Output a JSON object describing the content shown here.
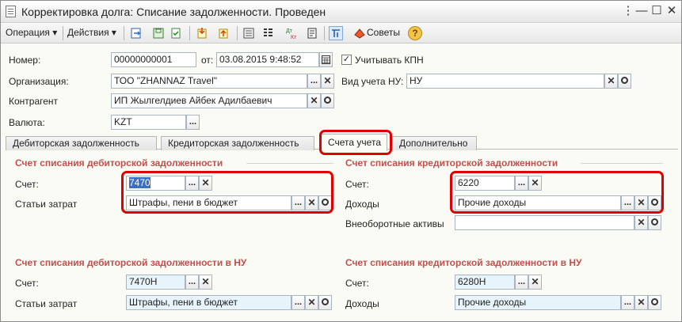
{
  "window": {
    "title": "Корректировка долга: Списание задолженности. Проведен",
    "controls": {
      "menu": "⋮",
      "minimize": "—",
      "maximize": "☐",
      "close": "✕"
    }
  },
  "toolbar": {
    "operation": "Операция",
    "actions": "Действия",
    "tips": "Советы",
    "help": "?"
  },
  "header": {
    "number_label": "Номер:",
    "number_value": "00000000001",
    "date_label": "от:",
    "date_value": "03.08.2015  9:48:52",
    "kpn_label": "Учитывать КПН",
    "kpn_checked": "✓",
    "org_label": "Организация:",
    "org_value": "ТОО  \"ZHANNAZ Travel\"",
    "accounting_label": "Вид учета НУ:",
    "accounting_value": "НУ",
    "contractor_label": "Контрагент",
    "contractor_value": "ИП Жылгелдиев Айбек Адилбаевич",
    "currency_label": "Валюта:",
    "currency_value": "KZT"
  },
  "tabs": [
    {
      "label": "Дебиторская задолженность"
    },
    {
      "label": "Кредиторская задолженность"
    },
    {
      "label": "Счета учета"
    },
    {
      "label": "Дополнительно"
    }
  ],
  "debit": {
    "title": "Счет списания дебиторской задолженности",
    "account_label": "Счет:",
    "account_value": "7470",
    "expense_label": "Статьи затрат",
    "expense_value": "Штрафы, пени в бюджет"
  },
  "credit": {
    "title": "Счет списания кредиторской задолженности",
    "account_label": "Счет:",
    "account_value": "6220",
    "income_label": "Доходы",
    "income_value": "Прочие доходы",
    "assets_label": "Внеоборотные активы",
    "assets_value": ""
  },
  "debit_nu": {
    "title": "Счет списания дебиторской задолженности в НУ",
    "account_label": "Счет:",
    "account_value": "7470Н",
    "expense_label": "Статьи затрат",
    "expense_value": "Штрафы, пени в бюджет"
  },
  "credit_nu": {
    "title": "Счет списания кредиторской задолженности в НУ",
    "account_label": "Счет:",
    "account_value": "6280Н",
    "income_label": "Доходы",
    "income_value": "Прочие доходы"
  },
  "buttons": {
    "choose": "...",
    "clear": "✕"
  },
  "colors": {
    "section_title": "#c0504d",
    "highlight": "#e00000",
    "selection": "#3a6fc4"
  }
}
